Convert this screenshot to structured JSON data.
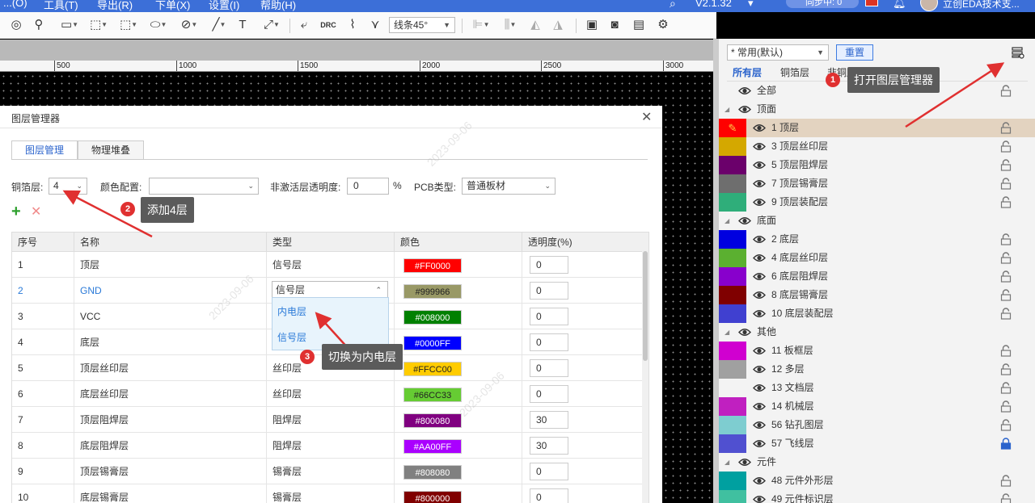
{
  "menubar": {
    "items": [
      "...(O)",
      "工具(T)",
      "导出(R)",
      "下单(X)",
      "设置(I)",
      "帮助(H)"
    ],
    "version": "V2.1.32",
    "sync_label": "同步中: 0",
    "user_label": "立创EDA技术支..."
  },
  "toolbar": {
    "line_mode": "线条45°"
  },
  "ruler": {
    "labels": [
      "500",
      "1000",
      "1500",
      "2000",
      "2500",
      "3000"
    ]
  },
  "right_panel": {
    "preset": "* 常用(默认)",
    "reset_label": "重置",
    "tabs": [
      "所有层",
      "铜箔层",
      "非铜层"
    ],
    "layers": [
      {
        "kind": "eye-row",
        "name": "全部"
      },
      {
        "kind": "group",
        "name": "顶面"
      },
      {
        "kind": "layer",
        "name": "1 顶层",
        "color": "#FF0000",
        "selected": true
      },
      {
        "kind": "layer",
        "name": "3 顶层丝印层",
        "color": "#D4A800"
      },
      {
        "kind": "layer",
        "name": "5 顶层阻焊层",
        "color": "#6B006B"
      },
      {
        "kind": "layer",
        "name": "7 顶层锡膏层",
        "color": "#6E6E6E"
      },
      {
        "kind": "layer",
        "name": "9 顶层装配层",
        "color": "#2FAE7A"
      },
      {
        "kind": "group",
        "name": "底面"
      },
      {
        "kind": "layer",
        "name": "2 底层",
        "color": "#0000E0"
      },
      {
        "kind": "layer",
        "name": "4 底层丝印层",
        "color": "#5BB030"
      },
      {
        "kind": "layer",
        "name": "6 底层阻焊层",
        "color": "#8800CC"
      },
      {
        "kind": "layer",
        "name": "8 底层锡膏层",
        "color": "#800000"
      },
      {
        "kind": "layer",
        "name": "10 底层装配层",
        "color": "#4040D0"
      },
      {
        "kind": "group",
        "name": "其他"
      },
      {
        "kind": "layer",
        "name": "11 板框层",
        "color": "#D000D0"
      },
      {
        "kind": "layer",
        "name": "12 多层",
        "color": "#A0A0A0"
      },
      {
        "kind": "layer",
        "name": "13 文档层",
        "color": "#F3F3F3"
      },
      {
        "kind": "layer",
        "name": "14 机械层",
        "color": "#C020C0"
      },
      {
        "kind": "layer",
        "name": "56 钻孔图层",
        "color": "#7ECDD0"
      },
      {
        "kind": "layer",
        "name": "57 飞线层",
        "color": "#5050D0",
        "locked": true
      },
      {
        "kind": "group",
        "name": "元件"
      },
      {
        "kind": "layer",
        "name": "48 元件外形层",
        "color": "#00A0A0"
      },
      {
        "kind": "layer",
        "name": "49 元件标识层",
        "color": "#40C0A0"
      }
    ]
  },
  "dialog": {
    "title": "图层管理器",
    "tabs": [
      "图层管理",
      "物理堆叠"
    ],
    "copper_label": "铜箔层:",
    "copper_value": "4",
    "color_config_label": "颜色配置:",
    "color_config_value": "",
    "opacity_label": "非激活层透明度:",
    "opacity_value": "0",
    "opacity_unit": "%",
    "pcb_type_label": "PCB类型:",
    "pcb_type_value": "普通板材",
    "columns": [
      "序号",
      "名称",
      "类型",
      "颜色",
      "透明度(%)"
    ],
    "rows": [
      {
        "no": "1",
        "name": "顶层",
        "type": "信号层",
        "color": "#FF0000",
        "opacity": "0"
      },
      {
        "no": "2",
        "name": "GND",
        "type": "信号层",
        "color": "#999966",
        "opacity": "0",
        "selected": true
      },
      {
        "no": "3",
        "name": "VCC",
        "type": "",
        "color": "#008000",
        "opacity": "0"
      },
      {
        "no": "4",
        "name": "底层",
        "type": "",
        "color": "#0000FF",
        "opacity": "0"
      },
      {
        "no": "5",
        "name": "顶层丝印层",
        "type": "丝印层",
        "color": "#FFCC00",
        "opacity": "0"
      },
      {
        "no": "6",
        "name": "底层丝印层",
        "type": "丝印层",
        "color": "#66CC33",
        "opacity": "0"
      },
      {
        "no": "7",
        "name": "顶层阻焊层",
        "type": "阻焊层",
        "color": "#800080",
        "opacity": "30"
      },
      {
        "no": "8",
        "name": "底层阻焊层",
        "type": "阻焊层",
        "color": "#AA00FF",
        "opacity": "30"
      },
      {
        "no": "9",
        "name": "顶层锡膏层",
        "type": "锡膏层",
        "color": "#808080",
        "opacity": "0"
      },
      {
        "no": "10",
        "name": "底层锡膏层",
        "type": "锡膏层",
        "color": "#800000",
        "opacity": "0"
      }
    ],
    "type_dropdown_options": [
      "内电层",
      "信号层"
    ]
  },
  "annotations": [
    {
      "num": "1",
      "text": "打开图层管理器"
    },
    {
      "num": "2",
      "text": "添加4层"
    },
    {
      "num": "3",
      "text": "切换为内电层"
    }
  ],
  "watermark": "2023-09-06"
}
